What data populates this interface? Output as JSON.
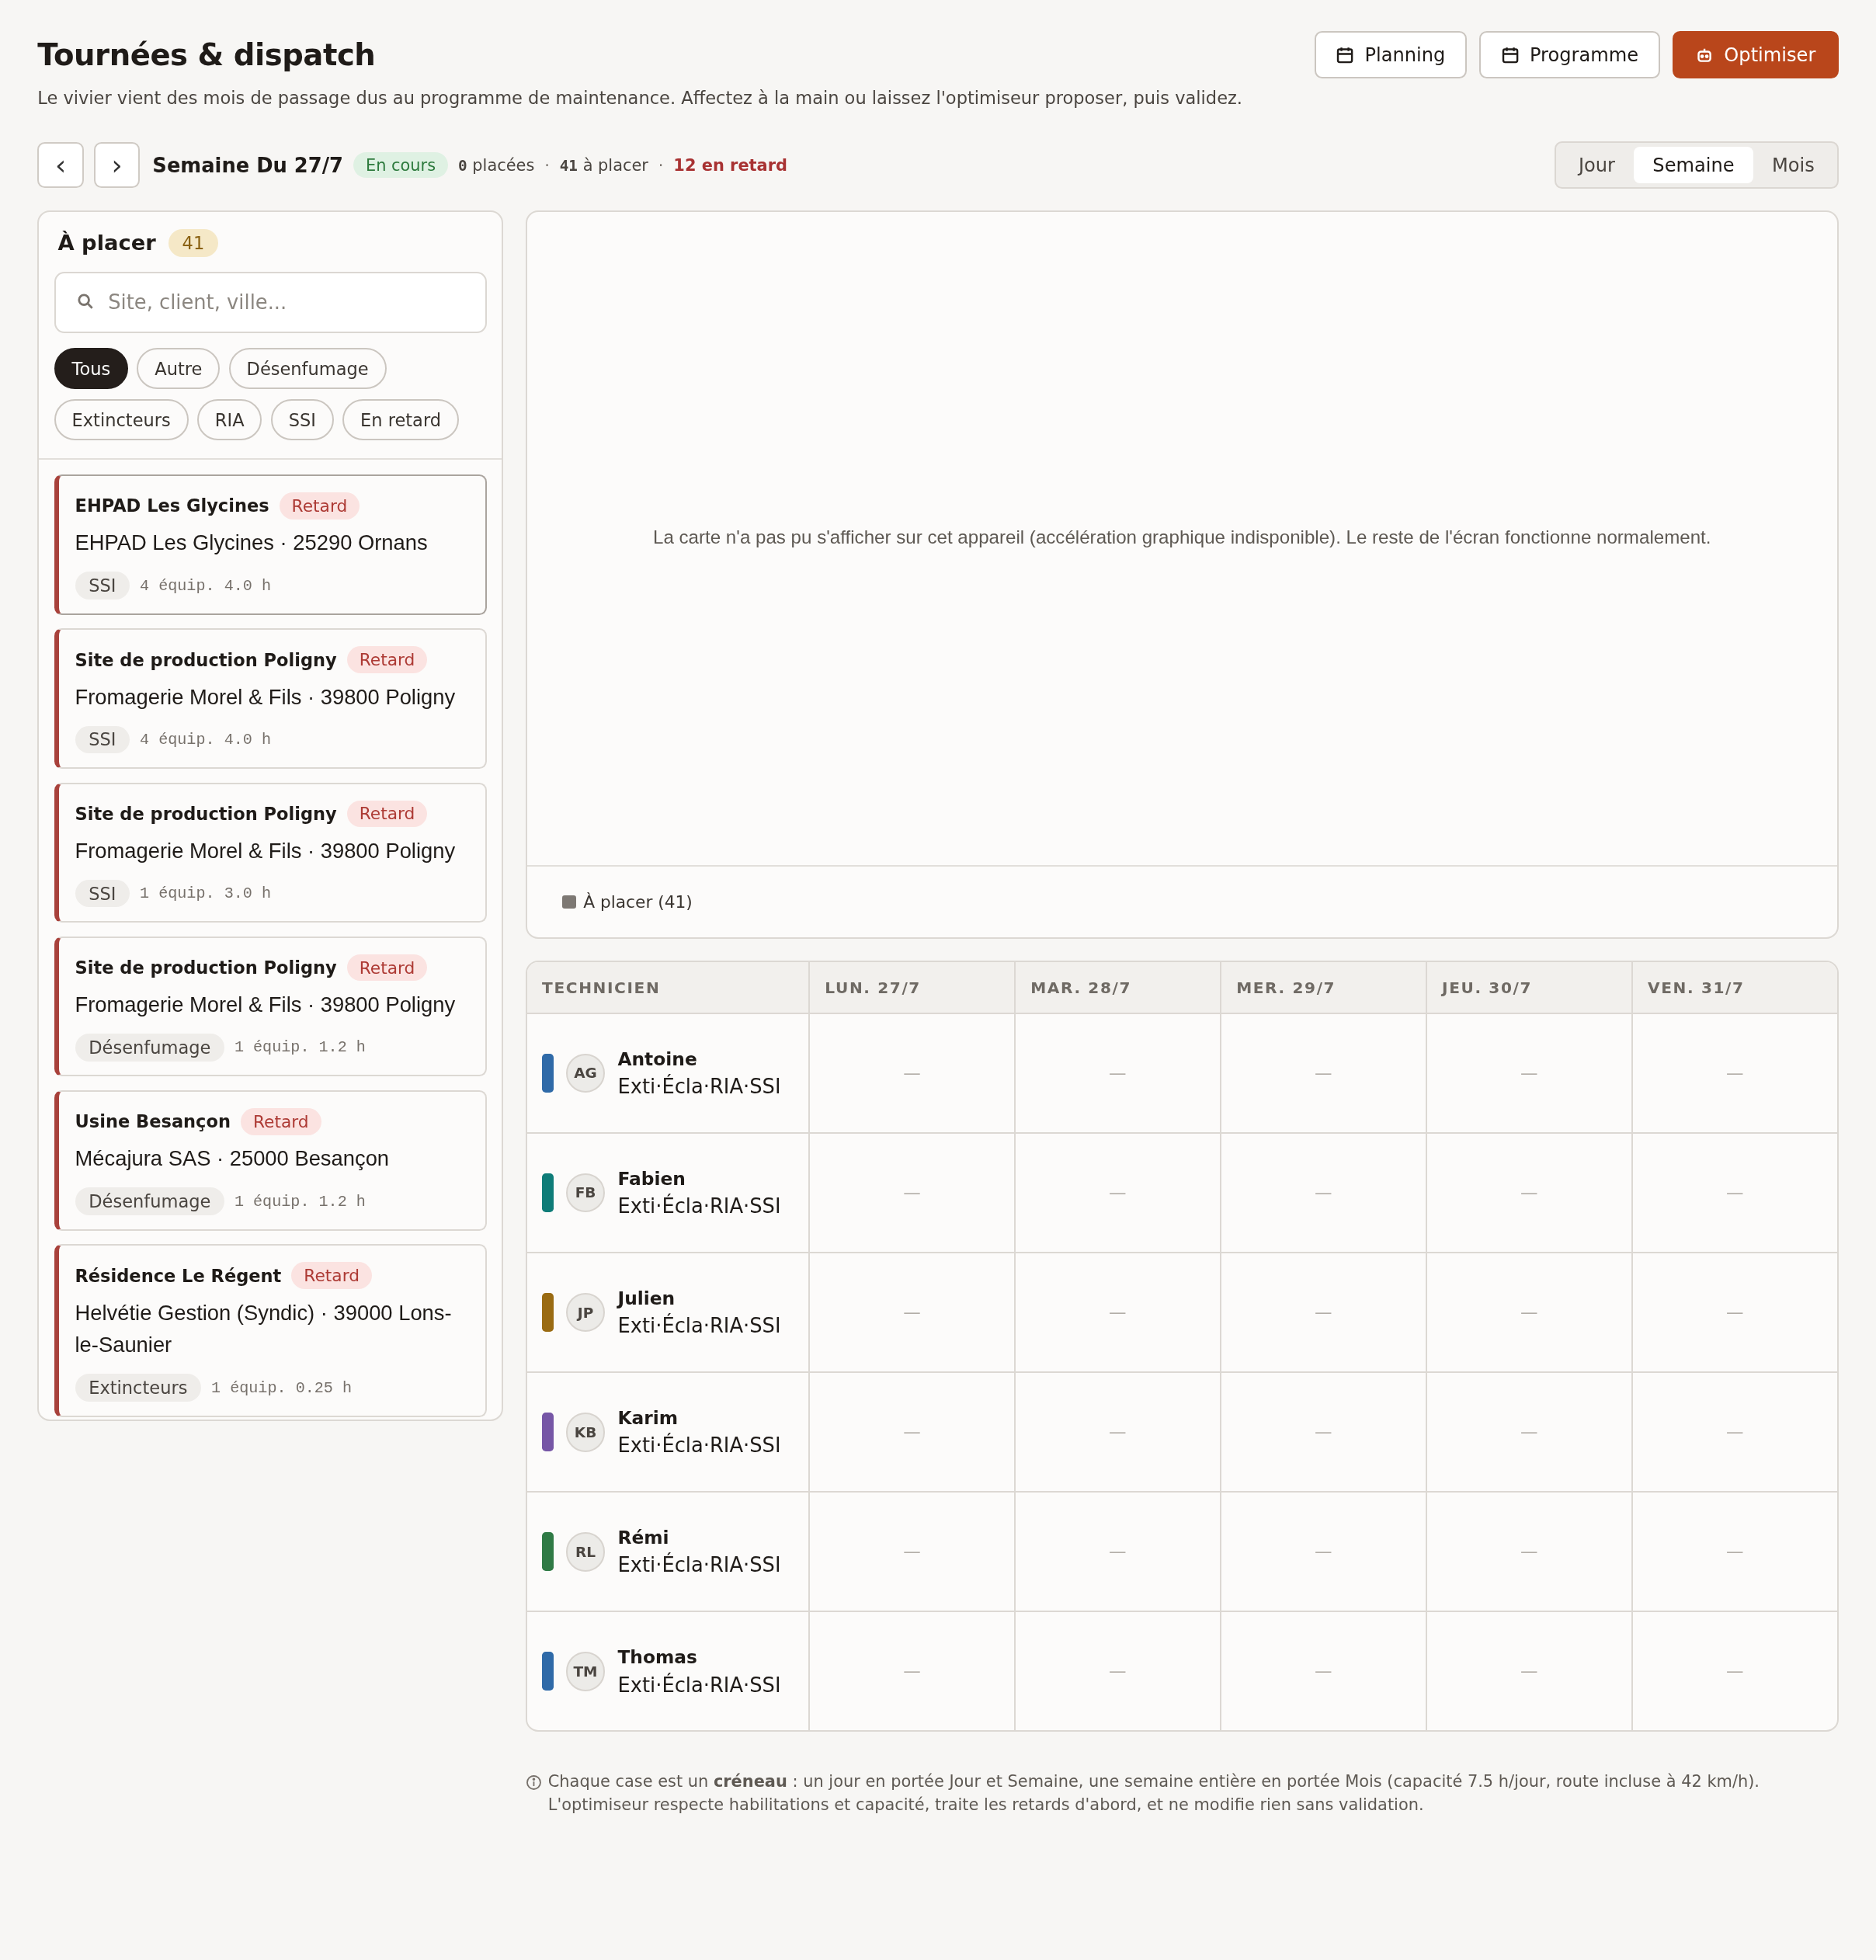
{
  "header": {
    "title": "Tournées & dispatch",
    "subtitle": "Le vivier vient des mois de passage dus au programme de maintenance. Affectez à la main ou laissez l'optimiseur proposer, puis validez.",
    "actions": [
      {
        "label": "Planning",
        "kind": "secondary"
      },
      {
        "label": "Programme",
        "kind": "secondary"
      },
      {
        "label": "Optimiser",
        "kind": "primary"
      }
    ]
  },
  "week_bar": {
    "prev": "‹",
    "next": "›",
    "title": "Semaine Du 27/7",
    "status": "En cours",
    "separator": "·",
    "stats": [
      {
        "number": "0",
        "label": "placées",
        "kind": "plain"
      },
      {
        "number": "41",
        "label": "à placer",
        "kind": "plain"
      },
      {
        "number": "12",
        "label": "en retard",
        "kind": "late"
      }
    ],
    "scopes": [
      {
        "label": "Jour",
        "selected": false
      },
      {
        "label": "Semaine",
        "selected": true
      },
      {
        "label": "Mois",
        "selected": false
      }
    ]
  },
  "pool": {
    "title": "À placer",
    "count": "41",
    "search": {
      "placeholder": "Site, client, ville..."
    },
    "filters": [
      {
        "label": "Tous",
        "selected": true
      },
      {
        "label": "Autre",
        "selected": false
      },
      {
        "label": "Désenfumage",
        "selected": false
      },
      {
        "label": "Extincteurs",
        "selected": false
      },
      {
        "label": "RIA",
        "selected": false
      },
      {
        "label": "SSI",
        "selected": false
      },
      {
        "label": "En retard",
        "selected": false
      }
    ],
    "jobs": [
      {
        "site": "EHPAD Les Glycines",
        "badge": "Retard",
        "late": true,
        "selected": true,
        "client": "EHPAD Les Glycines · 25290 Ornans",
        "tag": "SSI",
        "meta": "4 équip. 4.0 h"
      },
      {
        "site": "Site de production Poligny",
        "badge": "Retard",
        "late": true,
        "selected": false,
        "client": "Fromagerie Morel & Fils · 39800 Poligny",
        "tag": "SSI",
        "meta": "4 équip. 4.0 h"
      },
      {
        "site": "Site de production Poligny",
        "badge": "Retard",
        "late": true,
        "selected": false,
        "client": "Fromagerie Morel & Fils · 39800 Poligny",
        "tag": "SSI",
        "meta": "1 équip. 3.0 h"
      },
      {
        "site": "Site de production Poligny",
        "badge": "Retard",
        "late": true,
        "selected": false,
        "client": "Fromagerie Morel & Fils · 39800 Poligny",
        "tag": "Désenfumage",
        "meta": "1 équip. 1.2 h"
      },
      {
        "site": "Usine Besançon",
        "badge": "Retard",
        "late": true,
        "selected": false,
        "client": "Mécajura SAS · 25000 Besançon",
        "tag": "Désenfumage",
        "meta": "1 équip. 1.2 h"
      },
      {
        "site": "Résidence Le Régent",
        "badge": "Retard",
        "late": true,
        "selected": false,
        "client": "Helvétie Gestion (Syndic) · 39000 Lons-le-Saunier",
        "tag": "Extincteurs",
        "meta": "1 équip. 0.25 h"
      }
    ]
  },
  "map": {
    "message": "La carte n'a pas pu s'afficher sur cet appareil (accélération graphique indisponible). Le reste de l'écran fonctionne normalement.",
    "legend": [
      {
        "label": "À placer (41)",
        "color": "#7d7873"
      }
    ]
  },
  "schedule": {
    "columns": [
      "TECHNICIEN",
      "LUN. 27/7",
      "MAR. 28/7",
      "MER. 29/7",
      "JEU. 30/7",
      "VEN. 31/7"
    ],
    "rows": [
      {
        "cells": [
          {
            "kind": "technician",
            "initials": "AG",
            "name": "Antoine",
            "skills": "Exti·Écla·RIA·SSI",
            "color": "#2f6aa8"
          },
          {
            "kind": "slot",
            "text": "—"
          },
          {
            "kind": "slot",
            "text": "—"
          },
          {
            "kind": "slot",
            "text": "—"
          },
          {
            "kind": "slot",
            "text": "—"
          },
          {
            "kind": "slot",
            "text": "—"
          }
        ]
      },
      {
        "cells": [
          {
            "kind": "technician",
            "initials": "FB",
            "name": "Fabien",
            "skills": "Exti·Écla·RIA·SSI",
            "color": "#0e7c78"
          },
          {
            "kind": "slot",
            "text": "—"
          },
          {
            "kind": "slot",
            "text": "—"
          },
          {
            "kind": "slot",
            "text": "—"
          },
          {
            "kind": "slot",
            "text": "—"
          },
          {
            "kind": "slot",
            "text": "—"
          }
        ]
      },
      {
        "cells": [
          {
            "kind": "technician",
            "initials": "JP",
            "name": "Julien",
            "skills": "Exti·Écla·RIA·SSI",
            "color": "#9a6b12"
          },
          {
            "kind": "slot",
            "text": "—"
          },
          {
            "kind": "slot",
            "text": "—"
          },
          {
            "kind": "slot",
            "text": "—"
          },
          {
            "kind": "slot",
            "text": "—"
          },
          {
            "kind": "slot",
            "text": "—"
          }
        ]
      },
      {
        "cells": [
          {
            "kind": "technician",
            "initials": "KB",
            "name": "Karim",
            "skills": "Exti·Écla·RIA·SSI",
            "color": "#7656a6"
          },
          {
            "kind": "slot",
            "text": "—"
          },
          {
            "kind": "slot",
            "text": "—"
          },
          {
            "kind": "slot",
            "text": "—"
          },
          {
            "kind": "slot",
            "text": "—"
          },
          {
            "kind": "slot",
            "text": "—"
          }
        ]
      },
      {
        "cells": [
          {
            "kind": "technician",
            "initials": "RL",
            "name": "Rémi",
            "skills": "Exti·Écla·RIA·SSI",
            "color": "#2f7a45"
          },
          {
            "kind": "slot",
            "text": "—"
          },
          {
            "kind": "slot",
            "text": "—"
          },
          {
            "kind": "slot",
            "text": "—"
          },
          {
            "kind": "slot",
            "text": "—"
          },
          {
            "kind": "slot",
            "text": "—"
          }
        ]
      },
      {
        "cells": [
          {
            "kind": "technician",
            "initials": "TM",
            "name": "Thomas",
            "skills": "Exti·Écla·RIA·SSI",
            "color": "#2f6aa8"
          },
          {
            "kind": "slot",
            "text": "—"
          },
          {
            "kind": "slot",
            "text": "—"
          },
          {
            "kind": "slot",
            "text": "—"
          },
          {
            "kind": "slot",
            "text": "—"
          },
          {
            "kind": "slot",
            "text": "—"
          }
        ]
      }
    ]
  },
  "note": {
    "lines": [
      "Chaque case est un **créneau** : un jour en portée Jour et Semaine, une semaine entière en portée Mois (capacité 7.5 h/jour, route incluse à 42 km/h).",
      "L'optimiseur respecte habilitations et capacité, traite les retards d'abord, et ne modifie rien sans validation."
    ]
  }
}
